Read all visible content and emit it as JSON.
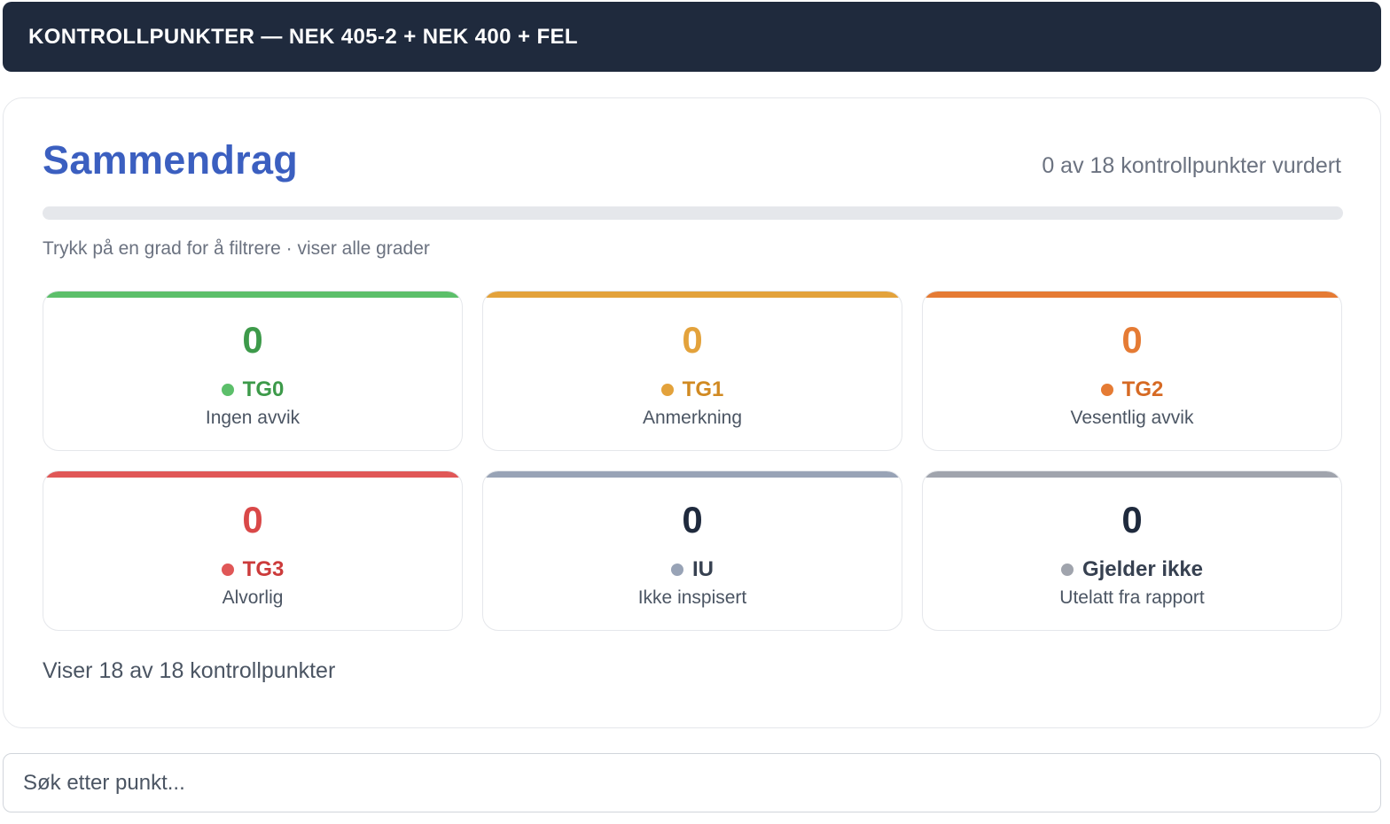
{
  "header": {
    "title": "KONTROLLPUNKTER — NEK 405-2 + NEK 400 + FEL"
  },
  "summary": {
    "title": "Sammendrag",
    "evaluated_text": "0 av 18 kontrollpunkter vurdert",
    "progress": 0,
    "filter_hint": "Trykk på en grad for å filtrere · viser alle grader",
    "grades": [
      {
        "count": "0",
        "code": "TG0",
        "description": "Ingen avvik",
        "bar_color": "#5cbf6a",
        "value_color": "#3d9a4a",
        "dot_color": "#5cbf6a",
        "code_color": "#3d9a4a"
      },
      {
        "count": "0",
        "code": "TG1",
        "description": "Anmerkning",
        "bar_color": "#e3a23b",
        "value_color": "#e3a23b",
        "dot_color": "#e3a23b",
        "code_color": "#d18a22"
      },
      {
        "count": "0",
        "code": "TG2",
        "description": "Vesentlig avvik",
        "bar_color": "#e57b34",
        "value_color": "#e57b34",
        "dot_color": "#e57b34",
        "code_color": "#d66a24"
      },
      {
        "count": "0",
        "code": "TG3",
        "description": "Alvorlig",
        "bar_color": "#e05757",
        "value_color": "#d94848",
        "dot_color": "#e05757",
        "code_color": "#cc3b3b"
      },
      {
        "count": "0",
        "code": "IU",
        "description": "Ikke inspisert",
        "bar_color": "#98a3b6",
        "value_color": "#1f2a3d",
        "dot_color": "#98a3b6",
        "code_color": "#374151"
      },
      {
        "count": "0",
        "code": "Gjelder ikke",
        "description": "Utelatt fra rapport",
        "bar_color": "#a0a4ad",
        "value_color": "#1f2a3d",
        "dot_color": "#a0a4ad",
        "code_color": "#374151"
      }
    ],
    "showing_text": "Viser 18 av 18 kontrollpunkter"
  },
  "search": {
    "placeholder": "Søk etter punkt..."
  }
}
